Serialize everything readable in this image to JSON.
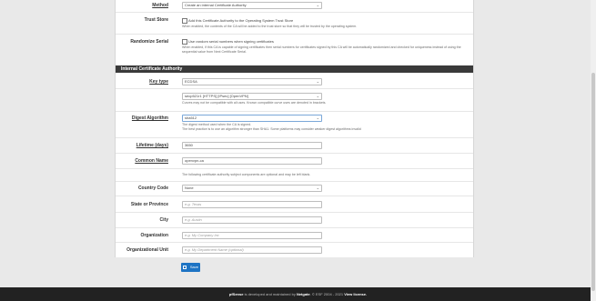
{
  "method": {
    "label": "Method",
    "value": "Create an internal Certificate Authority"
  },
  "trust_store": {
    "label": "Trust Store",
    "checkbox_text": "Add this Certificate Authority to the Operating System Trust Store",
    "help": "When enabled, the contents of the CA will be added to the trust store so that they will be trusted by the operating system."
  },
  "randomize_serial": {
    "label": "Randomize Serial",
    "checkbox_text": "Use random serial numbers when signing certificates",
    "help": "When enabled, if this CA is capable of signing certificates then serial numbers for certificates signed by this CA will be automatically randomized and checked for uniqueness instead of using the sequential value from Next Certificate Serial."
  },
  "section_title": "Internal Certificate Authority",
  "key_type": {
    "label": "Key type",
    "value": "ECDSA",
    "curve": "secp521r1 [HTTPS] [IPsec] [OpenVPN]",
    "help": "Curves may not be compatible with all uses. Known compatible curve uses are denoted in brackets."
  },
  "digest": {
    "label": "Digest Algorithm",
    "value": "sha512",
    "help1": "The digest method used when the CA is signed.",
    "help2": "The best practice is to use an algorithm stronger than SHA1. Some platforms may consider weaker digest algorithms invalid"
  },
  "lifetime": {
    "label": "Lifetime (days)",
    "value": "3650"
  },
  "common_name": {
    "label": "Common Name",
    "value": "openvpn-ca"
  },
  "subject_help": "The following certificate authority subject components are optional and may be left blank.",
  "country": {
    "label": "Country Code",
    "value": "None"
  },
  "state": {
    "label": "State or Province",
    "placeholder": "e.g. Texas"
  },
  "city": {
    "label": "City",
    "placeholder": "e.g. Austin"
  },
  "org": {
    "label": "Organization",
    "placeholder": "e.g. My Company Inc"
  },
  "org_unit": {
    "label": "Organizational Unit",
    "placeholder": "e.g. My Department Name (optional)"
  },
  "save_label": "Save",
  "footer": {
    "brand": "pfSense",
    "text1": " is developed and maintained by ",
    "company": "Netgate",
    "text2": ". © ESF 2004 - 2021 ",
    "license": "View license."
  }
}
